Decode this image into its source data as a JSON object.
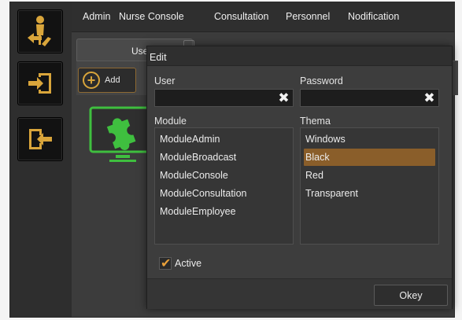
{
  "menu": {
    "items": [
      {
        "label": "Admin",
        "name": "menu-item-admin"
      },
      {
        "label": "Nurse Console",
        "name": "menu-item-nurse-console"
      },
      {
        "label": "Consultation",
        "name": "menu-item-consultation"
      },
      {
        "label": "Personnel",
        "name": "menu-item-personnel"
      },
      {
        "label": "Nodification",
        "name": "menu-item-nodification"
      }
    ]
  },
  "sidebar": {
    "buttons": [
      {
        "icon": "user-admin-icon"
      },
      {
        "icon": "login-icon"
      },
      {
        "icon": "logout-icon"
      }
    ]
  },
  "background": {
    "tab_label": "Users",
    "add_label": "Add",
    "module_icon": "puzzle-piece-icon"
  },
  "dialog": {
    "title": "Edit",
    "user_label": "User",
    "user_value": "",
    "password_label": "Password",
    "password_value": "",
    "module_label": "Module",
    "modules": [
      "ModuleAdmin",
      "ModuleBroadcast",
      "ModuleConsole",
      "ModuleConsultation",
      "ModuleEmployee"
    ],
    "theme_label": "Thema",
    "themes": [
      "Windows",
      "Black",
      "Red",
      "Transparent"
    ],
    "selected_theme": "Black",
    "active_label": "Active",
    "active_checked": true,
    "okey_label": "Okey",
    "clear_glyph": "✖"
  },
  "colors": {
    "accent": "#d9a53b",
    "selection": "#8a5e2a",
    "module_icon": "#3fbf3f"
  }
}
